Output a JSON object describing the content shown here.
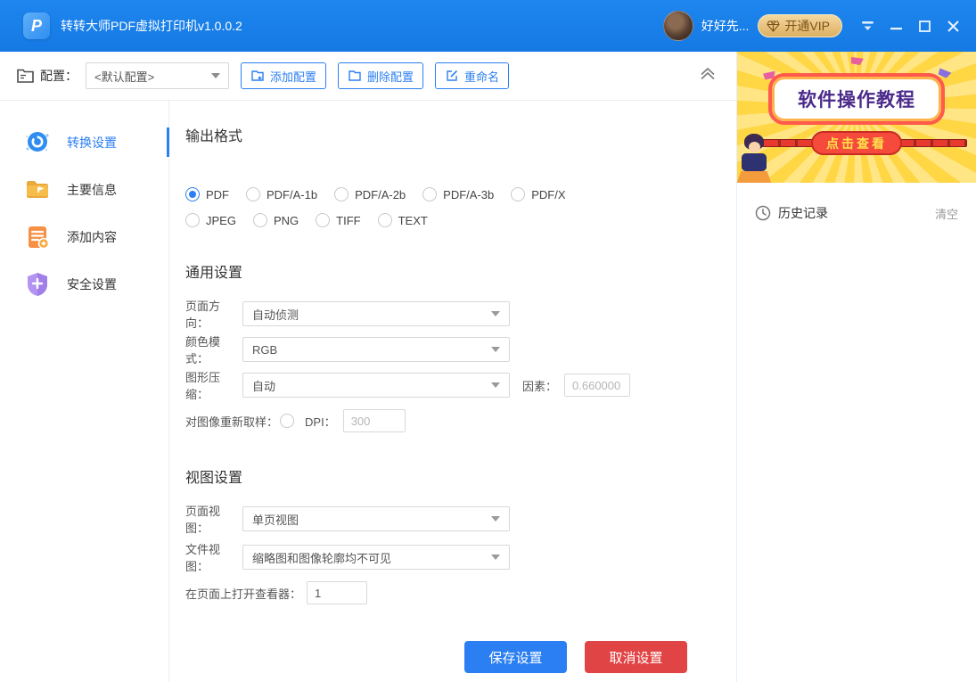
{
  "titlebar": {
    "title": "转转大师PDF虚拟打印机v1.0.0.2",
    "app_logo_letter": "P",
    "username": "好好先...",
    "vip_label": "开通VIP"
  },
  "toolbar": {
    "config_label": "配置：",
    "config_value": "<默认配置>",
    "add_button": "添加配置",
    "delete_button": "删除配置",
    "rename_button": "重命名"
  },
  "sidebar": {
    "items": [
      {
        "label": "转换设置",
        "icon": "convert-settings-icon",
        "selected": true
      },
      {
        "label": "主要信息",
        "icon": "main-info-icon",
        "selected": false
      },
      {
        "label": "添加内容",
        "icon": "add-content-icon",
        "selected": false
      },
      {
        "label": "安全设置",
        "icon": "security-settings-icon",
        "selected": false
      }
    ]
  },
  "output_format": {
    "heading": "输出格式",
    "options": [
      "PDF",
      "PDF/A-1b",
      "PDF/A-2b",
      "PDF/A-3b",
      "PDF/X",
      "JPEG",
      "PNG",
      "TIFF",
      "TEXT"
    ],
    "selected": "PDF"
  },
  "general_settings": {
    "heading": "通用设置",
    "page_orientation_label": "页面方向：",
    "page_orientation_value": "自动侦测",
    "color_mode_label": "颜色模式：",
    "color_mode_value": "RGB",
    "compression_label": "图形压缩：",
    "compression_value": "自动",
    "factor_label": "因素：",
    "factor_value": "0.660000",
    "resample_label": "对图像重新取样：",
    "resample_checked": false,
    "dpi_label": "DPI：",
    "dpi_value": "300"
  },
  "view_settings": {
    "heading": "视图设置",
    "page_view_label": "页面视图：",
    "page_view_value": "单页视图",
    "file_view_label": "文件视图：",
    "file_view_value": "缩略图和图像轮廓均不可见",
    "viewer_label": "在页面上打开查看器：",
    "viewer_value": "1"
  },
  "actions": {
    "save_label": "保存设置",
    "cancel_label": "取消设置"
  },
  "right_panel": {
    "ad_title": "软件操作教程",
    "ad_button": "点击查看",
    "history_title": "历史记录",
    "clear_label": "清空"
  },
  "colors": {
    "titlebar_blue": "#1a7fe9",
    "accent_blue": "#2b7ff2",
    "save_blue": "#2b7ff2",
    "cancel_red": "#e14444",
    "vip_gold": "#ddaf62",
    "ad_yellow": "#ffd644",
    "ad_red": "#ff5a4c",
    "ad_purple": "#4b2a8a"
  }
}
